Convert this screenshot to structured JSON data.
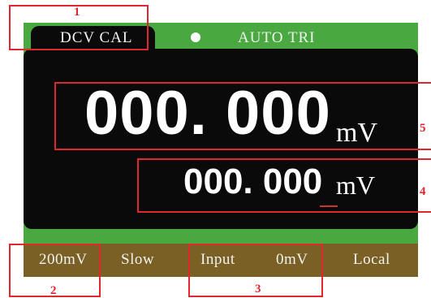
{
  "header": {
    "mode": "DCV CAL",
    "trigger": "AUTO TRI"
  },
  "display": {
    "main_value": "000. 000",
    "main_unit": "mV",
    "sub_value": "000. 000",
    "sub_unit": "mV"
  },
  "softkeys": {
    "range": "200mV",
    "speed": "Slow",
    "input_label": "Input",
    "input_value": "0mV",
    "local": "Local"
  },
  "callouts": [
    "1",
    "2",
    "3",
    "4",
    "5"
  ],
  "colors": {
    "panel_green": "#49a83f",
    "display_black": "#0a0a0a",
    "softkey_brown": "#7a6024",
    "callout_red": "#e0262f",
    "cursor_red": "#c8362d"
  }
}
